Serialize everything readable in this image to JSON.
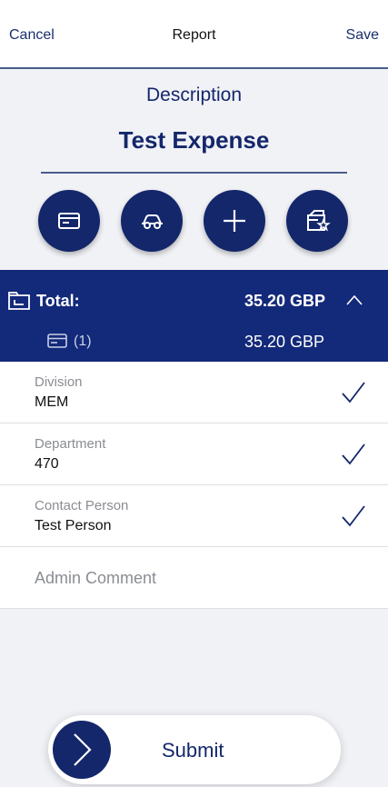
{
  "header": {
    "cancel_label": "Cancel",
    "title": "Report",
    "save_label": "Save"
  },
  "description": {
    "label": "Description",
    "value": "Test Expense"
  },
  "actions": [
    {
      "name": "card-icon"
    },
    {
      "name": "car-icon"
    },
    {
      "name": "plus-icon"
    },
    {
      "name": "wallet-star-icon"
    }
  ],
  "totals": {
    "label": "Total:",
    "amount": "35.20 GBP",
    "item_count": "(1)",
    "item_amount": "35.20 GBP"
  },
  "fields": [
    {
      "label": "Division",
      "value": "MEM",
      "checked": true
    },
    {
      "label": "Department",
      "value": "470",
      "checked": true
    },
    {
      "label": "Contact Person",
      "value": "Test Person",
      "checked": true
    }
  ],
  "comment": {
    "placeholder": "Admin Comment"
  },
  "submit": {
    "label": "Submit"
  },
  "colors": {
    "primary": "#14276b",
    "panel": "#13297a",
    "background": "#f1f2f6"
  }
}
